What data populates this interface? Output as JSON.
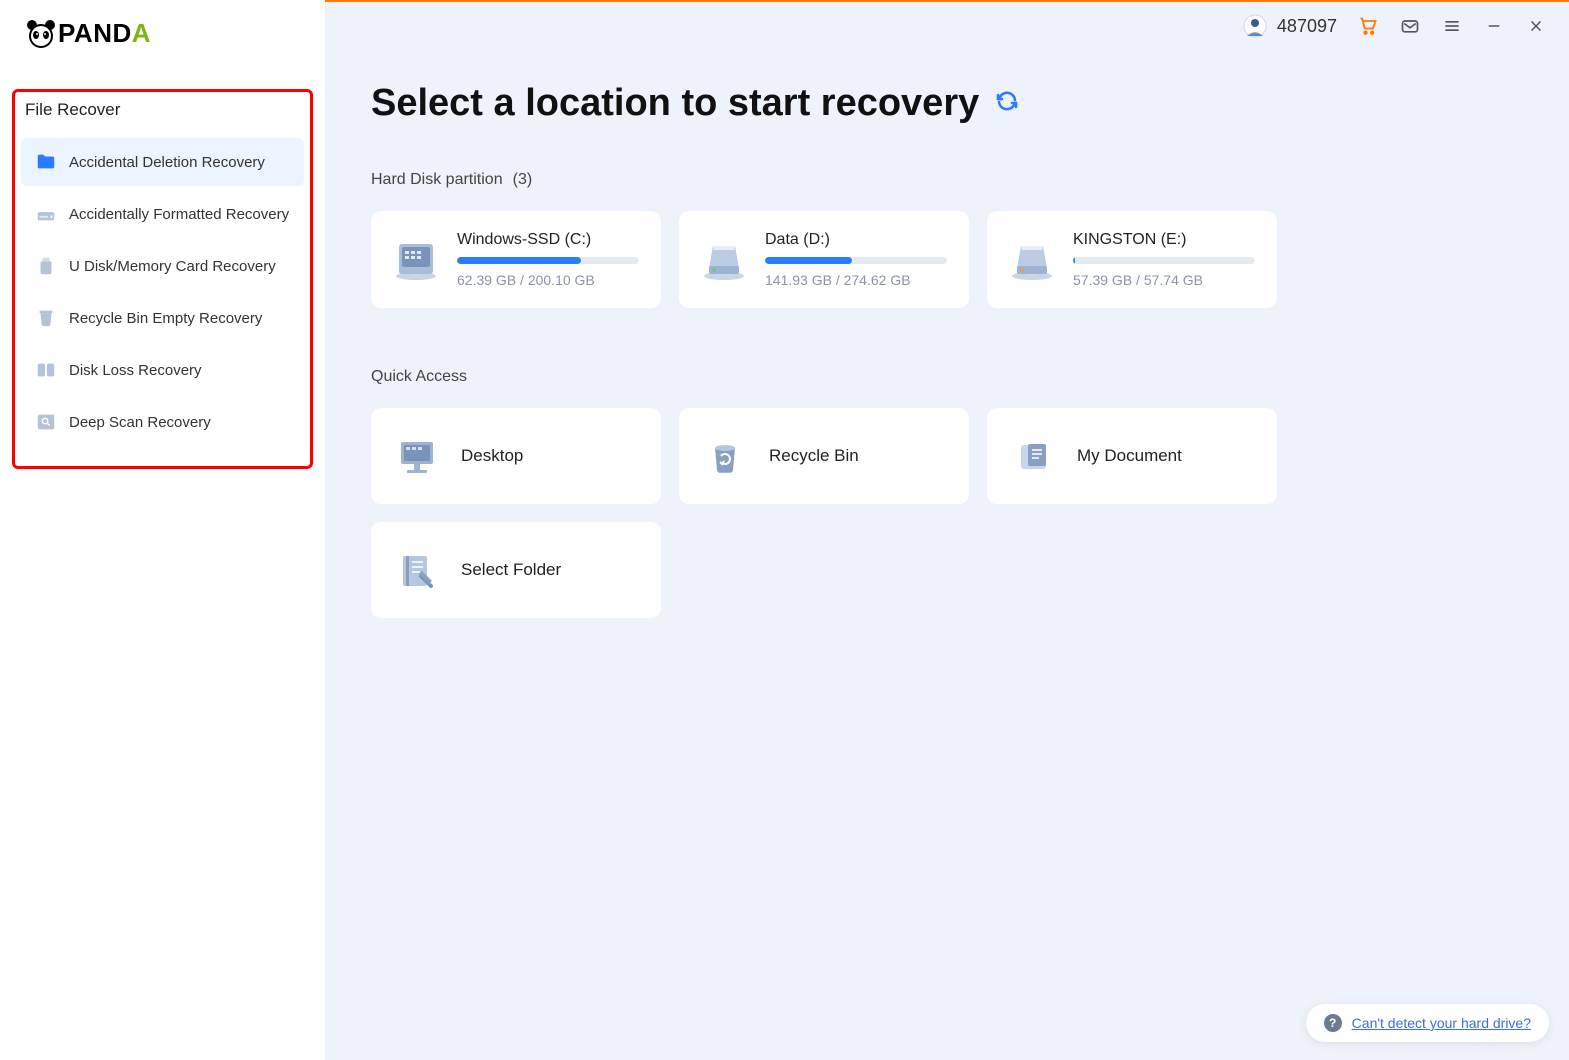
{
  "brand": "PANDA",
  "sidebar": {
    "section_title": "File Recover",
    "items": [
      {
        "label": "Accidental Deletion Recovery",
        "active": true,
        "icon": "folder"
      },
      {
        "label": "Accidentally Formatted Recovery",
        "active": false,
        "icon": "drive"
      },
      {
        "label": "U Disk/Memory Card Recovery",
        "active": false,
        "icon": "usb"
      },
      {
        "label": "Recycle Bin Empty Recovery",
        "active": false,
        "icon": "bin"
      },
      {
        "label": "Disk Loss Recovery",
        "active": false,
        "icon": "broken-disk"
      },
      {
        "label": "Deep Scan Recovery",
        "active": false,
        "icon": "deep-scan"
      }
    ]
  },
  "header": {
    "user_id": "487097"
  },
  "main": {
    "title": "Select a location to start recovery",
    "partition_heading": "Hard Disk partition",
    "partition_count": "(3)",
    "disks": [
      {
        "name": "Windows-SSD   (C:)",
        "size": "62.39 GB / 200.10 GB",
        "pct": 68,
        "variant": "ssd"
      },
      {
        "name": "Data   (D:)",
        "size": "141.93 GB / 274.62 GB",
        "pct": 48,
        "variant": "hdd"
      },
      {
        "name": "KINGSTON   (E:)",
        "size": "57.39 GB / 57.74 GB",
        "pct": 1,
        "variant": "hdd-orange"
      }
    ],
    "quick_heading": "Quick Access",
    "quick": [
      {
        "label": "Desktop",
        "icon": "desktop"
      },
      {
        "label": "Recycle Bin",
        "icon": "recycle"
      },
      {
        "label": "My Document",
        "icon": "document"
      },
      {
        "label": "Select Folder",
        "icon": "select-folder"
      }
    ],
    "help_link": "Can't detect your hard drive?"
  }
}
